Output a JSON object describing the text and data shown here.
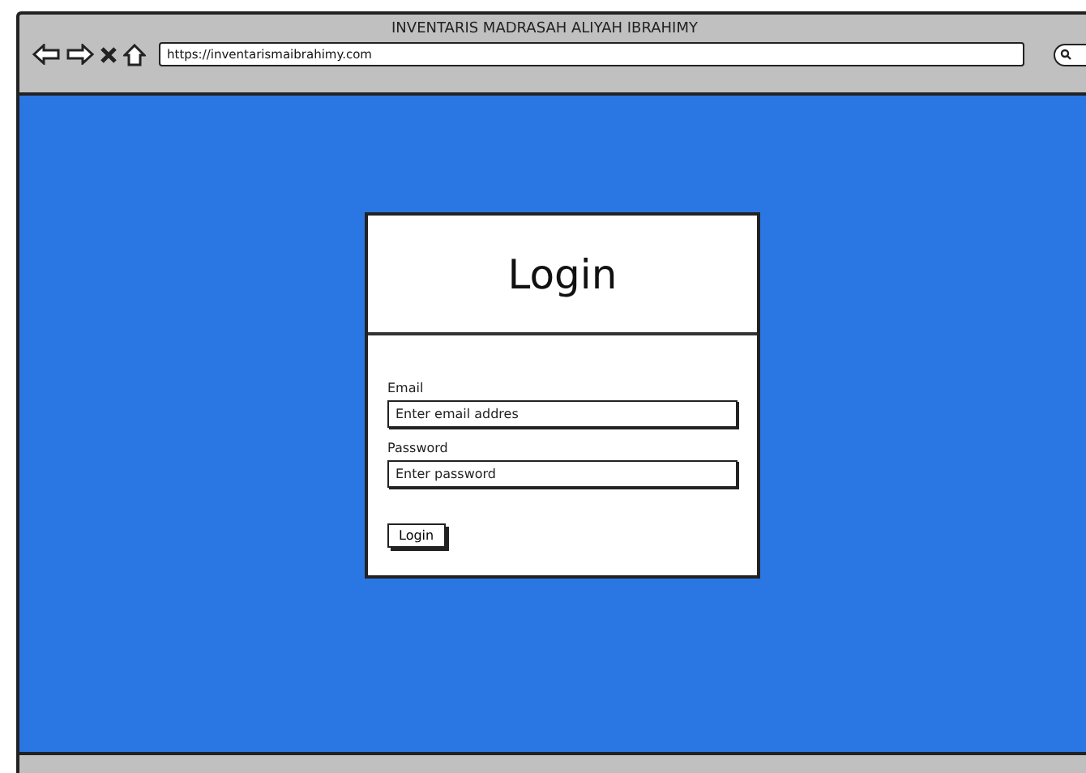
{
  "window": {
    "title": "INVENTARIS MADRASAH ALIYAH IBRAHIMY",
    "url": "https://inventarismaibrahimy.com"
  },
  "login": {
    "title": "Login",
    "fields": [
      {
        "label": "Email",
        "placeholder": "Enter email addres"
      },
      {
        "label": "Password",
        "placeholder": "Enter password"
      }
    ],
    "button": "Login"
  }
}
